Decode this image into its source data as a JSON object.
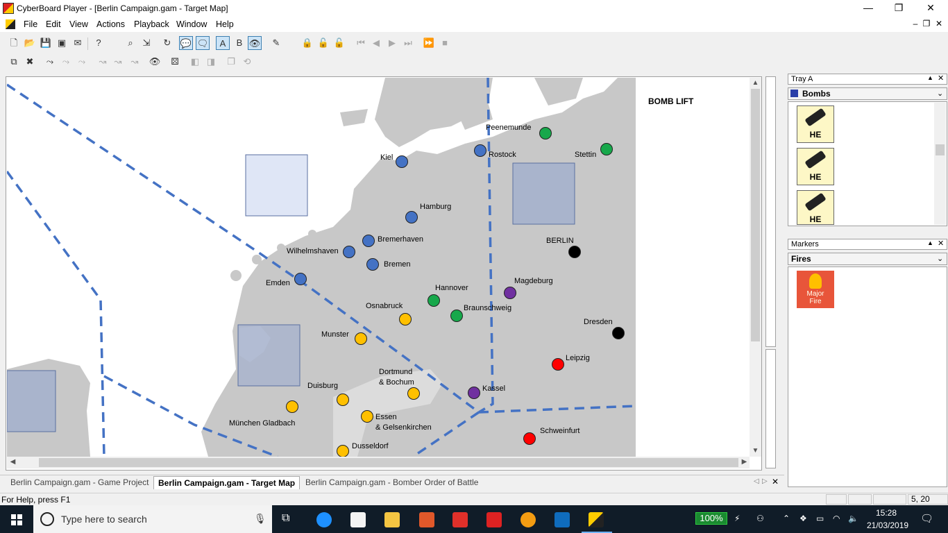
{
  "window": {
    "title": "CyberBoard Player - [Berlin Campaign.gam - Target Map]",
    "minimize": "—",
    "restore": "❐",
    "close": "✕"
  },
  "menubar": {
    "items": [
      "File",
      "Edit",
      "View",
      "Actions",
      "Playback",
      "Window",
      "Help"
    ],
    "mdi": {
      "minimize": "–",
      "restore": "❐",
      "close": "✕"
    }
  },
  "map": {
    "title_label": "BOMB LIFT",
    "colors": {
      "sea": "#ffffff",
      "land": "#c8c8c8",
      "ruhr": "#dcdcdc",
      "route": "#4472c4",
      "box_light": "#dfe6f6",
      "box_dark": "#a9b4cc",
      "blue": "#4472c4",
      "green": "#17a84b",
      "yellow": "#ffc000",
      "purple": "#7030a0",
      "black": "#000000",
      "red": "#ff0000"
    },
    "cities": [
      {
        "name": "Peenemunde",
        "color": "green"
      },
      {
        "name": "Rostock",
        "color": "blue"
      },
      {
        "name": "Stettin",
        "color": "green"
      },
      {
        "name": "Kiel",
        "color": "blue"
      },
      {
        "name": "Hamburg",
        "color": "blue"
      },
      {
        "name": "Bremerhaven",
        "color": "blue"
      },
      {
        "name": "Wilhelmshaven",
        "color": "blue"
      },
      {
        "name": "Bremen",
        "color": "blue"
      },
      {
        "name": "Emden",
        "color": "blue"
      },
      {
        "name": "BERLIN",
        "color": "black"
      },
      {
        "name": "Magdeburg",
        "color": "purple"
      },
      {
        "name": "Hannover",
        "color": "green"
      },
      {
        "name": "Braunschweig",
        "color": "green"
      },
      {
        "name": "Osnabruck",
        "color": "yellow"
      },
      {
        "name": "Munster",
        "color": "yellow"
      },
      {
        "name": "Dresden",
        "color": "black"
      },
      {
        "name": "Leipzig",
        "color": "red"
      },
      {
        "name": "Dortmund",
        "color": "yellow"
      },
      {
        "name": "Duisburg",
        "color": "yellow"
      },
      {
        "name": "Kassel",
        "color": "purple"
      },
      {
        "name": "München Gladbach",
        "color": "yellow"
      },
      {
        "name": "Essen",
        "color": "yellow"
      },
      {
        "name": "Schweinfurt",
        "color": "red"
      },
      {
        "name": "Dusseldorf",
        "color": "yellow"
      }
    ],
    "label_extra": {
      "dortmund_line2": "& Bochum",
      "essen_line2": "& Gelsenkirchen"
    }
  },
  "tabs": [
    {
      "label": "Berlin Campaign.gam - Game Project"
    },
    {
      "label": "Berlin Campaign.gam - Target Map"
    },
    {
      "label": "Berlin Campaign.gam - Bomber Order of Battle"
    }
  ],
  "tray_a": {
    "title": "Tray A",
    "group": "Bombs",
    "pieces": [
      "HE",
      "HE",
      "HE"
    ]
  },
  "markers": {
    "title": "Markers",
    "group": "Fires",
    "pieces": [
      {
        "line1": "Major",
        "line2": "Fire"
      }
    ]
  },
  "statusbar": {
    "help": "For Help, press F1",
    "coords": "5, 20"
  },
  "taskbar": {
    "search_placeholder": "Type here to search",
    "battery": "100%",
    "time": "15:28",
    "date": "21/03/2019"
  }
}
